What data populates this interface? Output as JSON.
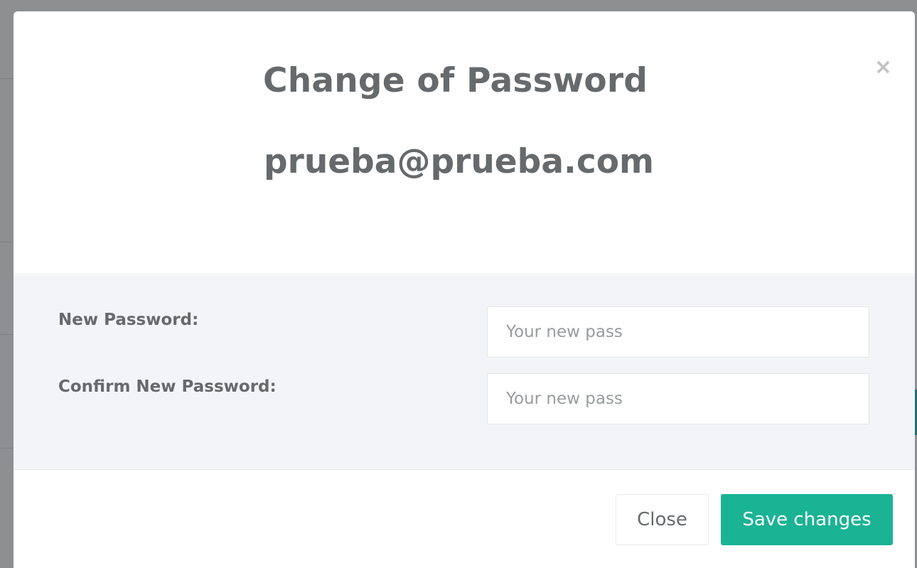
{
  "modal": {
    "title": "Change of Password",
    "email": "prueba@prueba.com",
    "close_icon": "×"
  },
  "form": {
    "new_password": {
      "label": "New Password:",
      "placeholder": "Your new pass",
      "value": ""
    },
    "confirm_password": {
      "label": "Confirm New Password:",
      "placeholder": "Your new pass",
      "value": ""
    }
  },
  "footer": {
    "close_label": "Close",
    "save_label": "Save changes"
  },
  "colors": {
    "overlay": "#8d8f91",
    "text": "#676a6c",
    "body_bg": "#f3f4f8",
    "primary": "#1ab394"
  }
}
